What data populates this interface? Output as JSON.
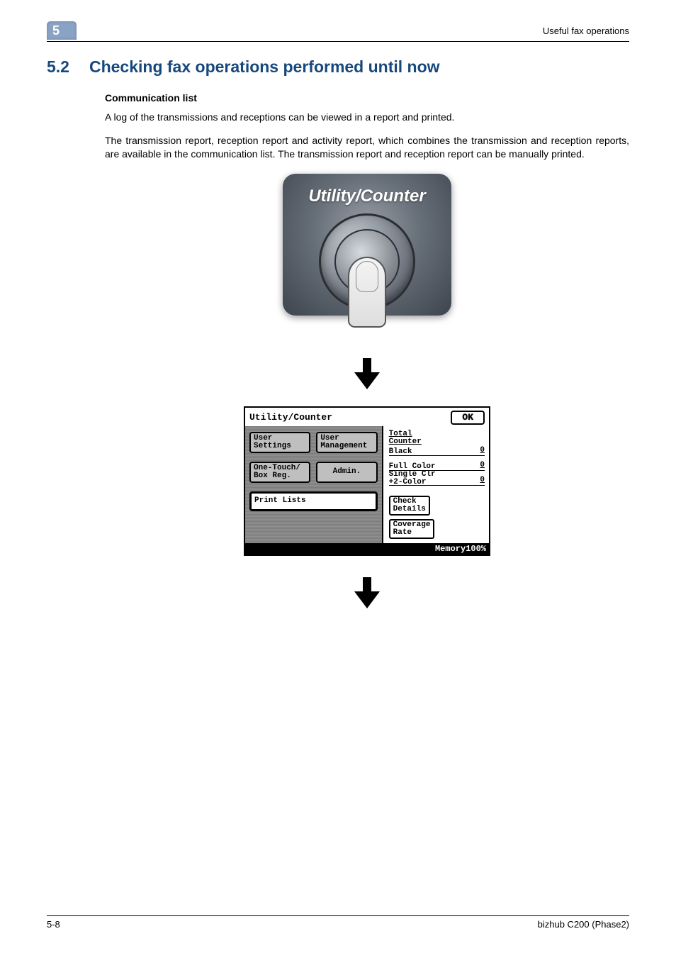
{
  "header": {
    "chapter_number": "5",
    "header_label": "Useful fax operations"
  },
  "section": {
    "number": "5.2",
    "title": "Checking fax operations performed until now"
  },
  "content": {
    "subhead": "Communication list",
    "para1": "A log of the transmissions and receptions can be viewed in a report and printed.",
    "para2": "The transmission report, reception report and activity report, which combines the transmission and reception reports, are available in the communication list. The transmission report and reception report can be manually printed."
  },
  "utility_button": {
    "label": "Utility/Counter"
  },
  "lcd": {
    "title": "Utility/Counter",
    "ok": "OK",
    "buttons": {
      "user_settings": "User\nSettings",
      "user_management": "User\nManagement",
      "one_touch": "One-Touch/\nBox Reg.",
      "admin": "Admin.",
      "print_lists": "Print Lists"
    },
    "counters": {
      "header1": "Total",
      "header2": "Counter",
      "black_label": "Black",
      "black_val": "0",
      "full_color_label": "Full Color",
      "full_color_val": "0",
      "single_label1": "Single Clr",
      "single_label2": "+2-Color",
      "single_val": "0",
      "check1": "Check",
      "check2": "Details",
      "coverage1": "Coverage",
      "coverage2": "Rate"
    },
    "memory": "Memory100%"
  },
  "footer": {
    "page": "5-8",
    "model": "bizhub C200 (Phase2)"
  }
}
